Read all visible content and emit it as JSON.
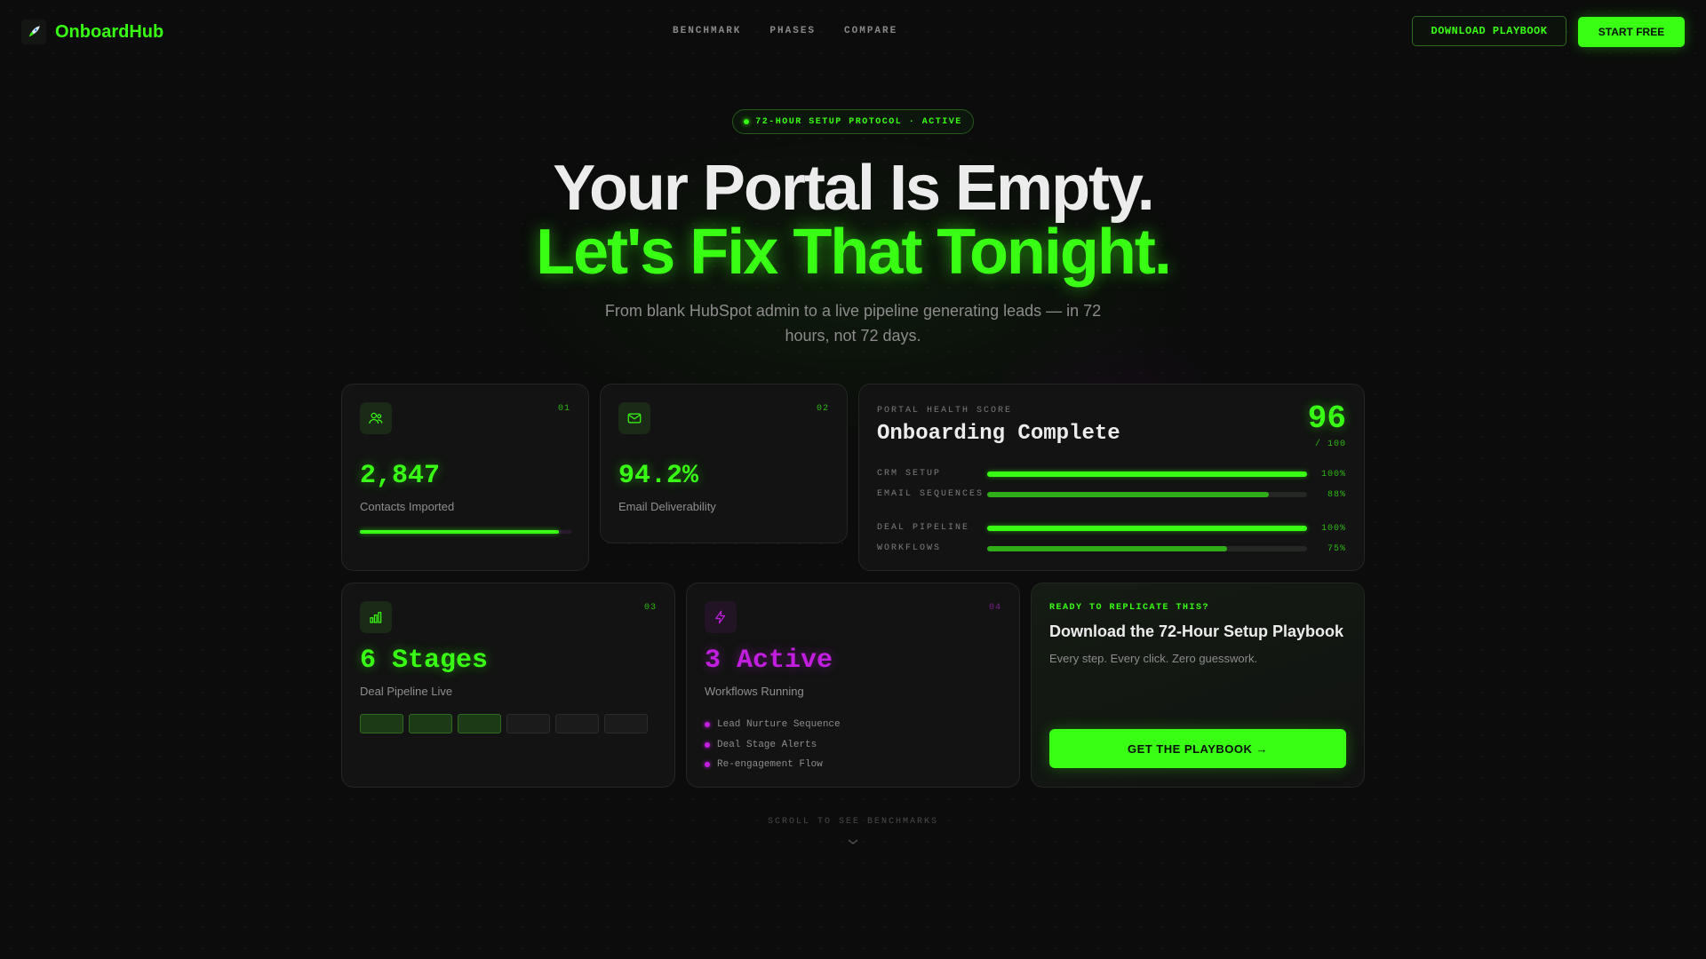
{
  "brand": {
    "name": "OnboardHub",
    "logo_icon": "rocket-icon",
    "accent": "#39ff14",
    "secondary": "#c21ee0"
  },
  "nav": {
    "links": [
      "BENCHMARK",
      "PHASES",
      "COMPARE"
    ],
    "download_label": "DOWNLOAD PLAYBOOK",
    "start_label": "START FREE"
  },
  "hero": {
    "badge": "72-HOUR SETUP PROTOCOL · ACTIVE",
    "line1": "Your Portal Is Empty.",
    "line2": "Let's Fix That Tonight.",
    "subtitle": "From blank HubSpot admin to a live pipeline generating leads — in 72 hours, not 72 days."
  },
  "cards": {
    "contacts": {
      "num": "01",
      "value": "2,847",
      "label": "Contacts Imported",
      "icon": "users-icon",
      "progress": 0.94
    },
    "email": {
      "num": "02",
      "value": "94.2%",
      "label": "Email Deliverability",
      "icon": "mail-icon"
    },
    "health": {
      "label": "PORTAL HEALTH SCORE",
      "title": "Onboarding Complete",
      "score": "96",
      "max": "/ 100",
      "rows": [
        {
          "label": "CRM SETUP",
          "pct": "100%",
          "value": 1.0
        },
        {
          "label": "EMAIL SEQUENCES",
          "pct": "88%",
          "value": 0.88
        },
        {
          "label": "DEAL PIPELINE",
          "pct": "100%",
          "value": 1.0
        },
        {
          "label": "WORKFLOWS",
          "pct": "75%",
          "value": 0.75
        }
      ]
    },
    "pipeline": {
      "num": "03",
      "value": "6 Stages",
      "label": "Deal Pipeline Live",
      "icon": "bar-chart-icon",
      "stages_total": 6,
      "stages_complete": 3
    },
    "workflows": {
      "num": "04",
      "value": "3 Active",
      "label": "Workflows Running",
      "icon": "lightning-icon",
      "items": [
        "Lead Nurture Sequence",
        "Deal Stage Alerts",
        "Re-engagement Flow"
      ]
    },
    "cta": {
      "kicker": "READY TO REPLICATE THIS?",
      "title": "Download the 72-Hour Setup Playbook",
      "subtitle": "Every step. Every click. Zero guesswork.",
      "button": "GET THE PLAYBOOK →"
    }
  },
  "scroll_hint": "SCROLL TO SEE BENCHMARKS"
}
